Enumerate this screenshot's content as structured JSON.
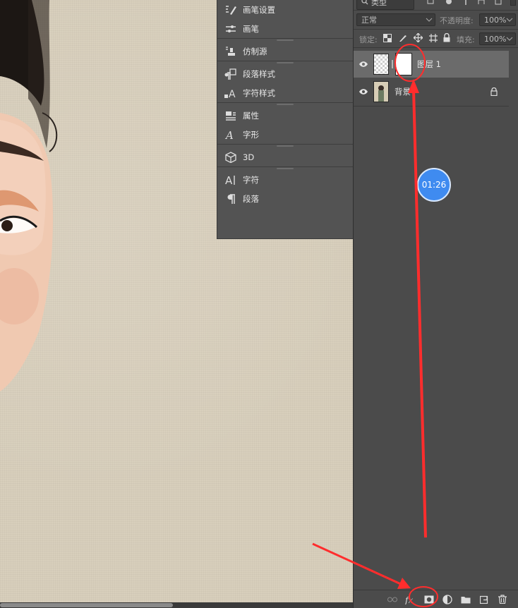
{
  "panel_menu": {
    "groups": [
      {
        "items": [
          {
            "label": "画笔设置",
            "icon": "brush-settings-icon"
          },
          {
            "label": "画笔",
            "icon": "brushes-icon"
          }
        ]
      },
      {
        "items": [
          {
            "label": "仿制源",
            "icon": "clone-source-icon"
          }
        ]
      },
      {
        "items": [
          {
            "label": "段落样式",
            "icon": "paragraph-styles-icon"
          },
          {
            "label": "字符样式",
            "icon": "character-styles-icon"
          }
        ]
      },
      {
        "items": [
          {
            "label": "属性",
            "icon": "properties-icon"
          },
          {
            "label": "字形",
            "icon": "glyphs-icon"
          }
        ]
      },
      {
        "items": [
          {
            "label": "3D",
            "icon": "3d-cube-icon"
          }
        ]
      },
      {
        "items": [
          {
            "label": "字符",
            "icon": "character-icon"
          },
          {
            "label": "段落",
            "icon": "paragraph-icon"
          }
        ]
      }
    ]
  },
  "layers": {
    "filter_kind": "类型",
    "blend_mode": "正常",
    "opacity_label": "不透明度:",
    "opacity_value": "100%",
    "lock_label": "锁定:",
    "fill_label": "填充:",
    "fill_value": "100%",
    "items": [
      {
        "name": "图层 1",
        "visible": true,
        "active": true,
        "has_mask": true
      },
      {
        "name": "背景",
        "visible": true,
        "active": false,
        "locked": true
      }
    ]
  },
  "timer": "01:26",
  "colors": {
    "accent_annotation": "#ff2d2d",
    "timer_blue": "#3f8bf0",
    "panel_bg": "#4b4b4b",
    "canvas_bg": "#d8cfbc"
  }
}
